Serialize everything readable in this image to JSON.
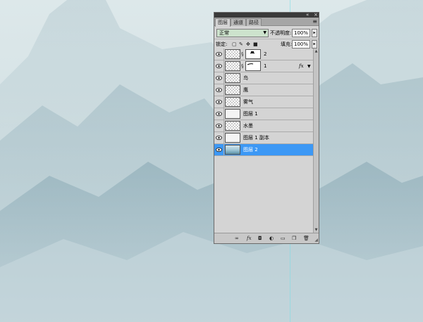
{
  "panel": {
    "tabs": [
      {
        "label": "图层",
        "active": true
      },
      {
        "label": "通道",
        "active": false
      },
      {
        "label": "路径",
        "active": false
      }
    ],
    "blend_mode": "正常",
    "opacity_label": "不透明度:",
    "opacity_value": "100%",
    "lock_label": "锁定:",
    "fill_label": "填充:",
    "fill_value": "100%",
    "layers": [
      {
        "name": "2",
        "thumb": "checker",
        "mask": true,
        "fx": false,
        "selected": false
      },
      {
        "name": "1",
        "thumb": "checker",
        "mask": true,
        "fx": true,
        "selected": false
      },
      {
        "name": "鸟",
        "thumb": "checker",
        "mask": false,
        "fx": false,
        "selected": false
      },
      {
        "name": "鹰",
        "thumb": "checker",
        "mask": false,
        "fx": false,
        "selected": false
      },
      {
        "name": "雾气",
        "thumb": "checker",
        "mask": false,
        "fx": false,
        "selected": false
      },
      {
        "name": "图层 1",
        "thumb": "plain",
        "mask": false,
        "fx": false,
        "selected": false
      },
      {
        "name": "水墨",
        "thumb": "checker",
        "mask": false,
        "fx": false,
        "selected": false
      },
      {
        "name": "图层 1 副本",
        "thumb": "plain",
        "mask": false,
        "fx": false,
        "selected": false
      },
      {
        "name": "图层 2",
        "thumb": "image",
        "mask": false,
        "fx": false,
        "selected": true
      }
    ],
    "fx_label": "fx",
    "icons": {
      "title_bar": [
        "collapse-icon",
        "close-icon"
      ],
      "lock": [
        "lock-transparent-icon",
        "lock-pixels-icon",
        "lock-position-icon",
        "lock-all-icon"
      ],
      "bottom": [
        "link-layers-icon",
        "add-style-icon",
        "add-mask-icon",
        "adjustment-layer-icon",
        "new-group-icon",
        "new-layer-icon",
        "delete-layer-icon"
      ]
    },
    "colors": {
      "selected": "#3c98f5",
      "blend_select_bg": "#cde3cd",
      "panel_bg": "#d4d4d4"
    }
  }
}
